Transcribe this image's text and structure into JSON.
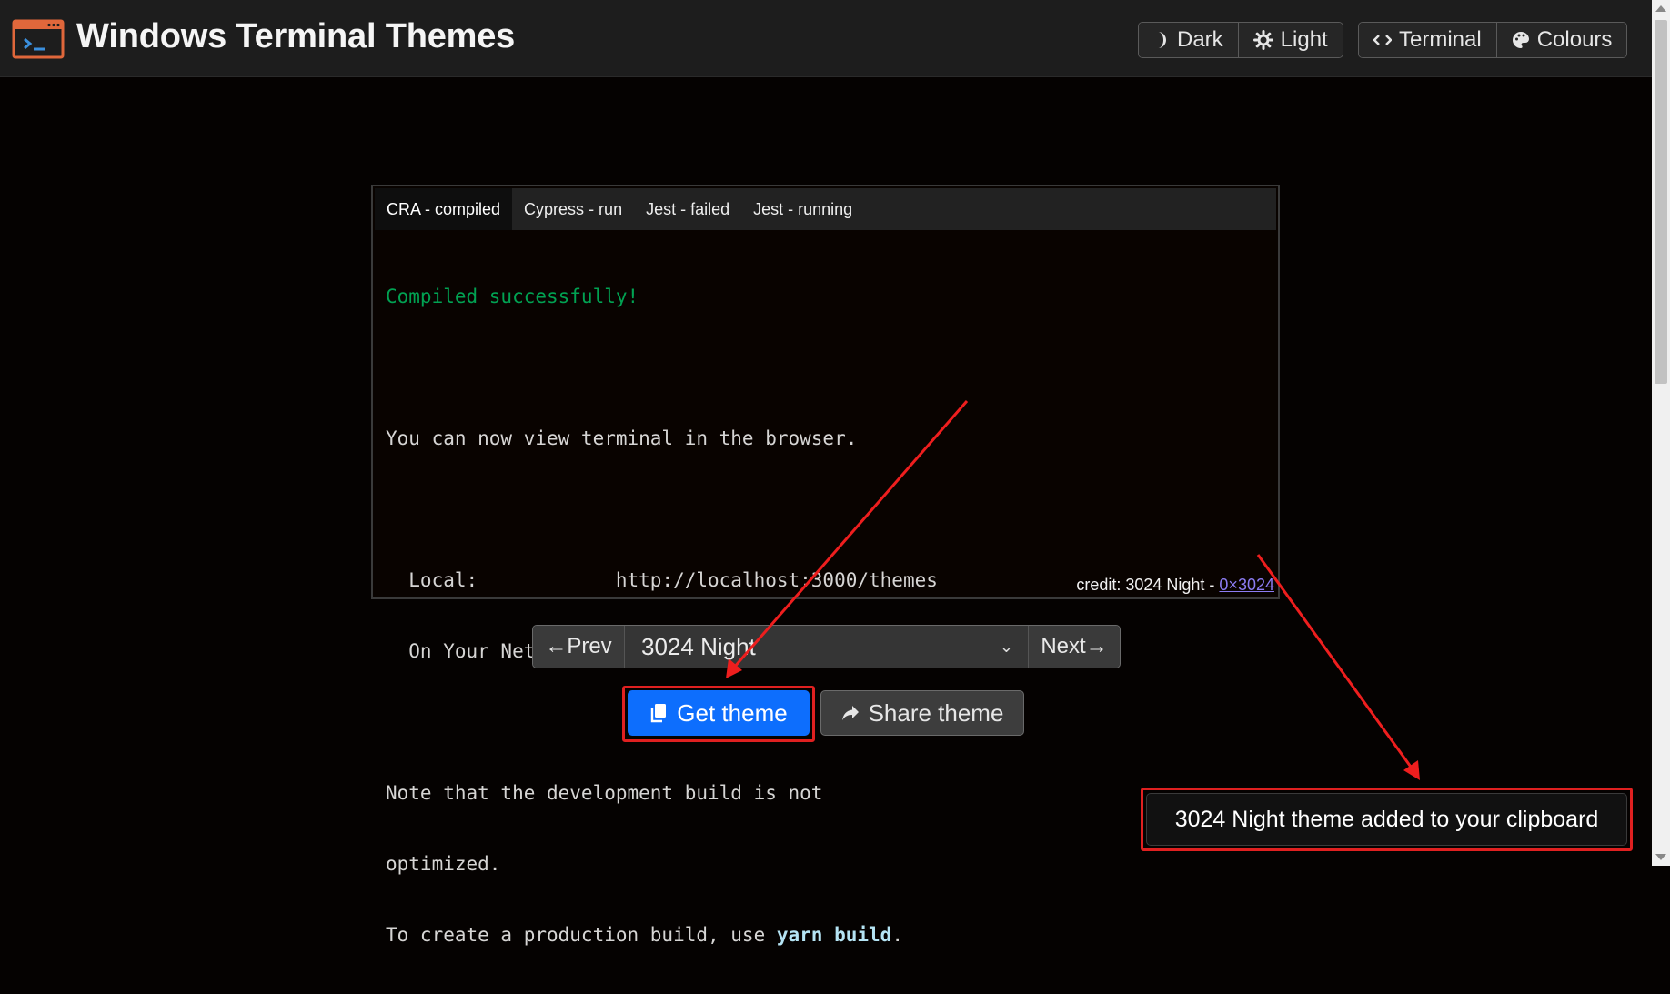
{
  "header": {
    "title": "Windows Terminal Themes",
    "mode_buttons": [
      {
        "label": "Dark",
        "icon": "moon-icon"
      },
      {
        "label": "Light",
        "icon": "sun-icon"
      }
    ],
    "view_buttons": [
      {
        "label": "Terminal",
        "icon": "code-icon"
      },
      {
        "label": "Colours",
        "icon": "palette-icon"
      }
    ]
  },
  "terminal": {
    "tabs": [
      "CRA - compiled",
      "Cypress - run",
      "Jest - failed",
      "Jest - running"
    ],
    "active_tab": "CRA - compiled",
    "lines": {
      "l1": "Compiled successfully!",
      "l2": "",
      "l3": "You can now view terminal in the browser.",
      "l4": "",
      "l5": "  Local:            http://localhost:3000/themes",
      "l6": "  On Your Network:  http://192.168.86.37:3000/themes",
      "l7": "",
      "l8": "Note that the development build is not",
      "l9": "optimized.",
      "l10_pre": "To create a production build, use ",
      "l10_cmd": "yarn build",
      "l10_post": "."
    },
    "credit_prefix": "credit: 3024 Night - ",
    "credit_link": "0×3024"
  },
  "selector": {
    "prev_label": "←Prev",
    "selected": "3024 Night",
    "next_label": "Next→"
  },
  "actions": {
    "get_label": "Get theme",
    "share_label": "Share theme"
  },
  "toast": {
    "message": "3024 Night theme added to your clipboard"
  },
  "colors": {
    "accent": "#0d6efd",
    "annotation": "#e02020",
    "terminal_green": "#01a252",
    "link": "#8c7cf3"
  }
}
